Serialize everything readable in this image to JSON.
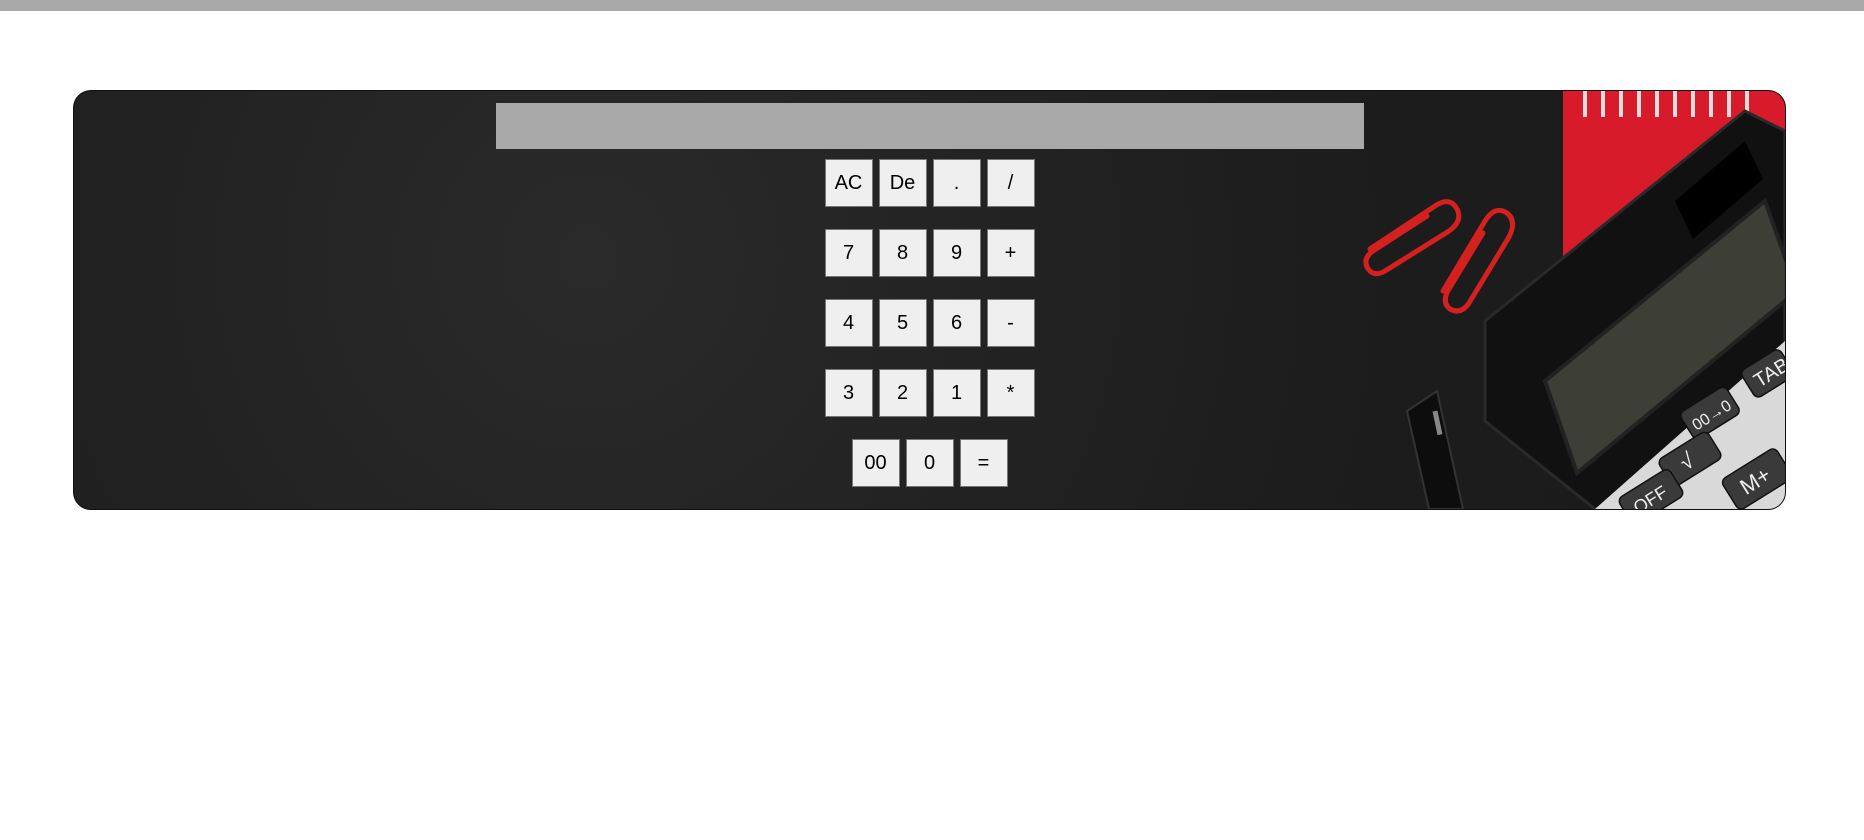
{
  "calculator": {
    "display_value": "",
    "rows": [
      [
        "AC",
        "De",
        ".",
        "/"
      ],
      [
        "7",
        "8",
        "9",
        "+"
      ],
      [
        "4",
        "5",
        "6",
        "-"
      ],
      [
        "3",
        "2",
        "1",
        "*"
      ],
      [
        "00",
        "0",
        "="
      ]
    ]
  },
  "decoration": {
    "items": [
      "paper-clip-icon",
      "paper-clip-icon",
      "pen-icon",
      "notebook-icon",
      "calculator-photo-icon"
    ],
    "calculator_keys": [
      "TAB",
      "00→0",
      "√",
      "OFF",
      "M+"
    ]
  },
  "colors": {
    "top_bar": "#a9a9a9",
    "background": "#1f1f1f",
    "display": "#a9a9a9",
    "key": "#efefef",
    "notebook": "#d81b2a",
    "clip": "#d52020"
  }
}
